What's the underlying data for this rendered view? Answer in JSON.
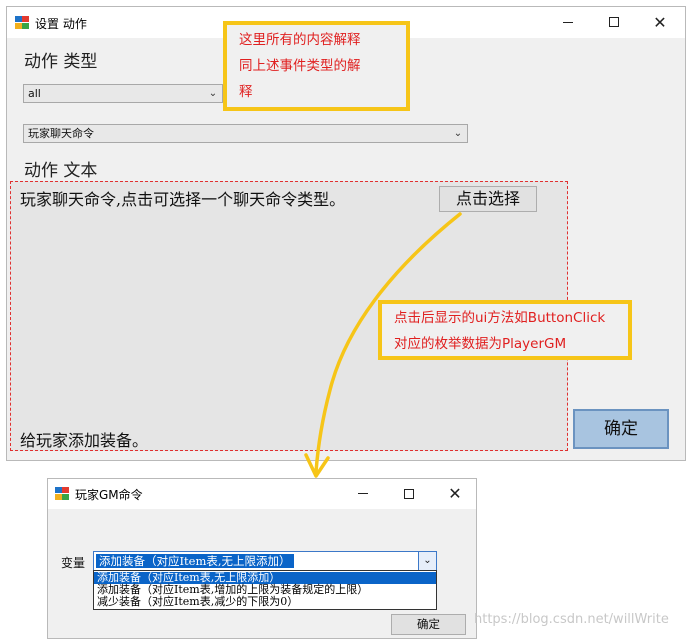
{
  "main_window": {
    "title": "设置 动作",
    "action_type_label": "动作 类型",
    "category_combo": {
      "value": "all"
    },
    "command_combo": {
      "value": "玩家聊天命令"
    },
    "action_text_label": "动作 文本",
    "description": "玩家聊天命令,点击可选择一个聊天命令类型。",
    "pick_button": "点击选择",
    "summary_text": "给玩家添加装备。",
    "confirm_button": "确定"
  },
  "annotations": {
    "top_note": [
      "这里所有的内容解释",
      "同上述事件类型的解",
      "释"
    ],
    "right_note": [
      "点击后显示的ui方法如ButtonClick",
      "对应的枚举数据为PlayerGM"
    ]
  },
  "gm_window": {
    "title": "玩家GM命令",
    "variable_label": "变量",
    "selected_value": "添加装备（对应Item表,无上限添加）",
    "options": [
      "添加装备（对应Item表,无上限添加）",
      "添加装备（对应Item表,增加的上限为装备规定的上限）",
      "减少装备（对应Item表,减少的下限为0）"
    ],
    "confirm_button": "确定"
  },
  "watermark": "https://blog.csdn.net/willWrite",
  "colors": {
    "annotation_border": "#f6c518",
    "annotation_text": "#e02020",
    "arrow": "#f6c518",
    "selection": "#0a64c8"
  }
}
